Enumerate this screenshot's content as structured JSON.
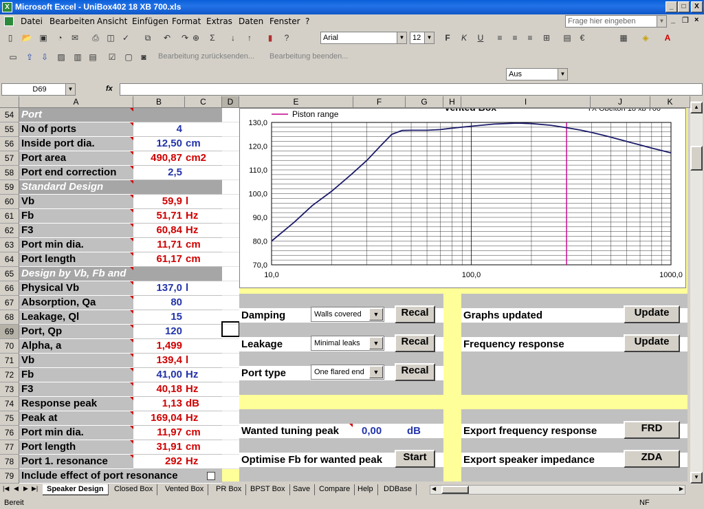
{
  "window": {
    "title": "Microsoft Excel - UniBox402 18 XB 700.xls",
    "minimize": "_",
    "maximize": "□",
    "close": "X"
  },
  "menu": [
    "Datei",
    "Bearbeiten",
    "Ansicht",
    "Einfügen",
    "Format",
    "Extras",
    "Daten",
    "Fenster",
    "?"
  ],
  "help_box": {
    "placeholder": "Frage hier eingeben"
  },
  "font": {
    "name": "Arial",
    "size": "12"
  },
  "review_toolbar": {
    "reply": "Bearbeitung zurücksenden...",
    "end": "Bearbeitung beenden..."
  },
  "aus_combo": "Aus",
  "name_box": "D69",
  "fx": "fx",
  "columns": [
    "A",
    "B",
    "C",
    "D",
    "E",
    "F",
    "G",
    "H",
    "I",
    "J",
    "K"
  ],
  "rows": [
    {
      "n": "54",
      "label": "Port",
      "section": true
    },
    {
      "n": "55",
      "label": "No of ports",
      "value": "4",
      "unit": "",
      "color": "blue"
    },
    {
      "n": "56",
      "label": "Inside port dia.",
      "value": "12,50",
      "unit": "cm",
      "color": "blue"
    },
    {
      "n": "57",
      "label": "Port area",
      "value": "490,87",
      "unit": "cm2",
      "color": "red"
    },
    {
      "n": "58",
      "label": "Port end correction",
      "value": "2,5",
      "unit": "",
      "color": "blue"
    },
    {
      "n": "59",
      "label": "Standard Design",
      "section": true
    },
    {
      "n": "60",
      "label": "Vb",
      "value": "59,9",
      "unit": "l",
      "color": "red"
    },
    {
      "n": "61",
      "label": "Fb",
      "value": "51,71",
      "unit": "Hz",
      "color": "red"
    },
    {
      "n": "62",
      "label": "F3",
      "value": "60,84",
      "unit": "Hz",
      "color": "red"
    },
    {
      "n": "63",
      "label": "Port min dia.",
      "value": "11,71",
      "unit": "cm",
      "color": "red"
    },
    {
      "n": "64",
      "label": "Port length",
      "value": "61,17",
      "unit": "cm",
      "color": "red"
    },
    {
      "n": "65",
      "label": "Design by Vb, Fb and Q",
      "section": true
    },
    {
      "n": "66",
      "label": "Physical Vb",
      "value": "137,0",
      "unit": "l",
      "color": "blue"
    },
    {
      "n": "67",
      "label": "Absorption, Qa",
      "value": "80",
      "unit": "",
      "color": "blue"
    },
    {
      "n": "68",
      "label": "Leakage, Ql",
      "value": "15",
      "unit": "",
      "color": "blue"
    },
    {
      "n": "69",
      "label": "Port, Qp",
      "value": "120",
      "unit": "",
      "color": "blue"
    },
    {
      "n": "70",
      "label": "Alpha, a",
      "value": "1,499",
      "unit": "",
      "color": "red"
    },
    {
      "n": "71",
      "label": "Vb",
      "value": "139,4",
      "unit": "l",
      "color": "red"
    },
    {
      "n": "72",
      "label": "Fb",
      "value": "41,00",
      "unit": "Hz",
      "color": "blue"
    },
    {
      "n": "73",
      "label": "F3",
      "value": "40,18",
      "unit": "Hz",
      "color": "red"
    },
    {
      "n": "74",
      "label": "Response peak",
      "value": "1,13",
      "unit": "dB",
      "color": "red"
    },
    {
      "n": "75",
      "label": "Peak at",
      "value": "169,04",
      "unit": "Hz",
      "color": "red"
    },
    {
      "n": "76",
      "label": "Port min dia.",
      "value": "11,97",
      "unit": "cm",
      "color": "red"
    },
    {
      "n": "77",
      "label": "Port length",
      "value": "31,91",
      "unit": "cm",
      "color": "red"
    },
    {
      "n": "78",
      "label": "Port 1. resonance",
      "value": "292",
      "unit": "Hz",
      "color": "red"
    },
    {
      "n": "79",
      "label": "Include effect of port resonance",
      "value": "",
      "unit": "",
      "color": "blue"
    }
  ],
  "chart_data": {
    "type": "line",
    "title": "Vented Box",
    "subtitle": "TX Obelton 18 xb 700",
    "legend": [
      "Piston range"
    ],
    "legend_position": "top-left",
    "x_scale": "log",
    "xlim": [
      10,
      1000
    ],
    "ylim": [
      70,
      130
    ],
    "x_ticks": [
      "10,0",
      "100,0",
      "1000,0"
    ],
    "y_ticks": [
      "70,0",
      "80,0",
      "90,0",
      "100,0",
      "110,0",
      "120,0",
      "130,0"
    ],
    "grid": true,
    "series": [
      {
        "name": "",
        "color": "#1a1a6a",
        "x": [
          10,
          13,
          16,
          20,
          25,
          30,
          35,
          40,
          45,
          50,
          60,
          70,
          80,
          100,
          130,
          170,
          200,
          250,
          300,
          350,
          400,
          500,
          600,
          700,
          800,
          1000
        ],
        "y": [
          80,
          88,
          95,
          101,
          108,
          114,
          120,
          125,
          126.6,
          126.7,
          126.7,
          127,
          127.6,
          128.4,
          129.3,
          129.7,
          129.5,
          128.8,
          127.8,
          126.8,
          125.8,
          123.8,
          122,
          120.5,
          119.2,
          117.2
        ]
      }
    ],
    "markers": [
      {
        "name": "Piston range",
        "x": 300,
        "color": "#c0008a"
      }
    ]
  },
  "controls": {
    "damping": {
      "label": "Damping",
      "value": "Walls covered",
      "button": "Recal"
    },
    "leakage": {
      "label": "Leakage",
      "value": "Minimal leaks",
      "button": "Recal"
    },
    "port_type": {
      "label": "Port type",
      "value": "One flared end",
      "button": "Recal"
    },
    "graphs_updated": {
      "label": "Graphs updated",
      "button": "Update"
    },
    "frequency_response": {
      "label": "Frequency response",
      "button": "Update"
    },
    "wanted_peak": {
      "label": "Wanted tuning peak",
      "value": "0,00",
      "unit": "dB"
    },
    "optimise": {
      "label": "Optimise Fb for wanted peak",
      "button": "Start"
    },
    "export_fr": {
      "label": "Export frequency response",
      "button": "FRD"
    },
    "export_imp": {
      "label": "Export speaker impedance",
      "button": "ZDA"
    }
  },
  "sheet_tabs": [
    "Speaker Design",
    "Closed Box",
    "Vented Box",
    "PR Box",
    "BPST Box",
    "Save",
    "Compare",
    "Help",
    "DDBase"
  ],
  "status": {
    "left": "Bereit",
    "right": "NF"
  }
}
